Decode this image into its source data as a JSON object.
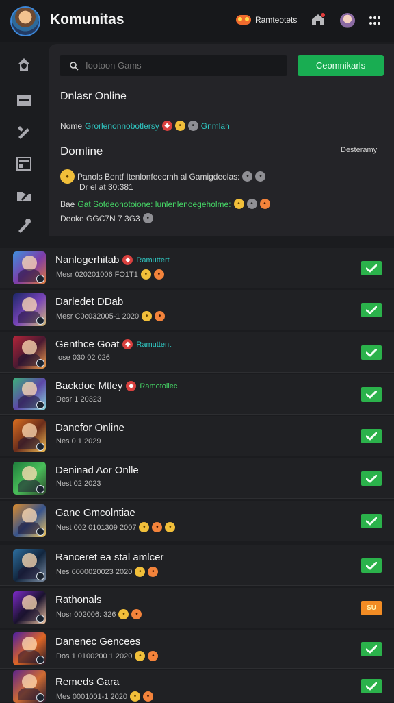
{
  "app": {
    "title": "Komunitas",
    "reward_label": "Ramteotets"
  },
  "search": {
    "placeholder": "Iootoon Gams",
    "button": "Ceomnikarls"
  },
  "feed": {
    "section_title": "Dnlasr Online",
    "line1_prefix": "Nome",
    "line1_link": "Grorlenonnobotlersy",
    "line1_tag": "Gnmlan",
    "online_title": "Domline",
    "online_status": "Desteramy",
    "line2_text": "Panols Bentf Itenlonfeecrnh al Gamigdeolas:",
    "line2_sub": "Dr el at 30:381",
    "line3_prefix": "Bae",
    "line3_link": "Gat Sotdeonotoione: lunlenlenoegeholme:",
    "line4_text": "Deoke GGC7N 7 3G3"
  },
  "list": [
    {
      "title": "Nanlogerhitab",
      "subtitle": "Mesr 020201006 FO1T1",
      "tag": "Ramuttert",
      "tag_color": "teal",
      "avatar": [
        "#3f8fdc",
        "#7d3ca8",
        "#df7c39"
      ],
      "action": "check"
    },
    {
      "title": "Darledet DDab",
      "subtitle": "Mesr C0c032005-1 2020",
      "tag": "",
      "tag_color": "",
      "avatar": [
        "#1c2768",
        "#7844b8",
        "#d4bc75"
      ],
      "action": "check"
    },
    {
      "title": "Genthce Goat",
      "subtitle": "Iose 030 02 026",
      "tag": "Ramuttent",
      "tag_color": "teal",
      "avatar": [
        "#b32539",
        "#4a1931",
        "#f1a04c"
      ],
      "action": "check"
    },
    {
      "title": "Backdoe Mtley",
      "subtitle": "Desr 1 20323",
      "tag": "Ramotoiiec",
      "tag_color": "green",
      "avatar": [
        "#3db27a",
        "#5c47a8",
        "#8ad7d9"
      ],
      "action": "check"
    },
    {
      "title": "Danefor Online",
      "subtitle": "Nes 0 1 2029",
      "tag": "",
      "tag_color": "",
      "avatar": [
        "#d96e20",
        "#6b2d1b",
        "#f2bf54"
      ],
      "action": "check"
    },
    {
      "title": "Deninad Aor Onlle",
      "subtitle": "Nest 02 2023",
      "tag": "",
      "tag_color": "",
      "avatar": [
        "#1f7d3c",
        "#49be59",
        "#2d492c"
      ],
      "action": "check"
    },
    {
      "title": "Gane Gmcolntiae",
      "subtitle": "Nest 002 0101309 2007",
      "tag": "",
      "tag_color": "",
      "avatar": [
        "#d98b2e",
        "#36538c",
        "#f2c75d"
      ],
      "action": "check"
    },
    {
      "title": "Ranceret ea stal amlcer",
      "subtitle": "Nes 6000020023 2020",
      "tag": "",
      "tag_color": "",
      "avatar": [
        "#2d6f9f",
        "#12263e",
        "#7e8fa5"
      ],
      "action": "check"
    },
    {
      "title": "Rathonals",
      "subtitle": "Nosr 002006: 326",
      "tag": "",
      "tag_color": "",
      "avatar": [
        "#7d2ac9",
        "#19122d",
        "#f1c7a4"
      ],
      "action": "orange",
      "action_label": "SU"
    },
    {
      "title": "Danenec Gencees",
      "subtitle": "Dos 1 0100200 1 2020",
      "tag": "",
      "tag_color": "",
      "avatar": [
        "#4b1ea2",
        "#de6625",
        "#1c1728"
      ],
      "action": "check"
    },
    {
      "title": "Remeds Gara",
      "subtitle": "Mes 0001001-1 2020",
      "tag": "",
      "tag_color": "",
      "avatar": [
        "#5c238c",
        "#d06c32",
        "#23172e"
      ],
      "action": "check"
    }
  ],
  "icons": {
    "home": "home-icon",
    "grid": "grid-icon",
    "search": "search-icon",
    "check": "check-icon"
  },
  "colors": {
    "background": "#1b1c1f",
    "panel": "#242428",
    "accent_green": "#19ad52",
    "teal": "#2fc5c0",
    "orange": "#f06b2d"
  }
}
